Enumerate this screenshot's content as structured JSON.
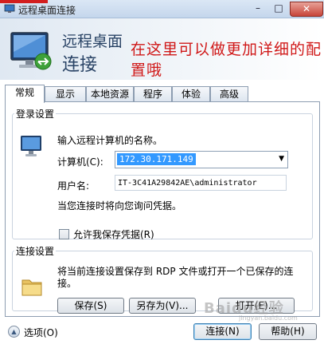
{
  "window": {
    "title": "远程桌面连接",
    "min_glyph": "–",
    "max_glyph": "□",
    "close_glyph": "✕"
  },
  "banner": {
    "line1": "远程桌面",
    "line2": "连接",
    "annotation": "在这里可以做更加详细的配置哦",
    "annotation_color": "#d01818"
  },
  "tabs": [
    "常规",
    "显示",
    "本地资源",
    "程序",
    "体验",
    "高级"
  ],
  "login": {
    "legend": "登录设置",
    "prompt": "输入远程计算机的名称。",
    "computer_label": "计算机(C):",
    "computer_value": "172.30.171.149",
    "username_label": "用户名:",
    "username_value": "IT-3C41A29842AE\\administrator",
    "hint": "当您连接时将向您询问凭据。",
    "save_credentials_label": "允许我保存凭据(R)",
    "save_credentials_checked": false
  },
  "connection": {
    "legend": "连接设置",
    "description": "将当前连接设置保存到 RDP 文件或打开一个已保存的连接。",
    "save_label": "保存(S)",
    "save_as_label": "另存为(V)...",
    "open_label": "打开(E)..."
  },
  "footer": {
    "options_label": "选项(O)",
    "connect_label": "连接(N)",
    "help_label": "帮助(H)"
  },
  "watermark": {
    "text": "Baidu经验",
    "sub": "jingyan.baidu.com"
  },
  "colors": {
    "selection": "#3399ff",
    "banner_text": "#2a4466"
  }
}
